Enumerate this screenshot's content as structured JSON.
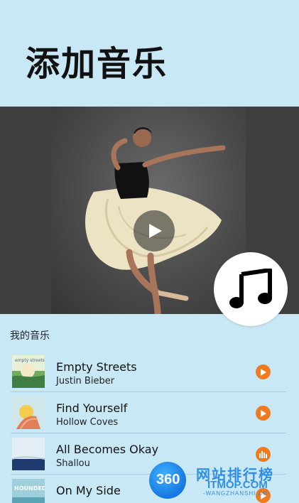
{
  "page": {
    "title": "添加音乐"
  },
  "video": {
    "play_icon": "play-icon"
  },
  "music_button": {
    "icon": "music-note-icon"
  },
  "section": {
    "label": "我的音乐"
  },
  "tracks": [
    {
      "name": "Empty Streets",
      "artist": "Justin Bieber",
      "action_icon": "play-icon",
      "thumb_text": "empty streets"
    },
    {
      "name": "Find Yourself",
      "artist": "Hollow  Coves",
      "action_icon": "play-icon",
      "thumb_text": ""
    },
    {
      "name": "All Becomes Okay",
      "artist": "Shallou",
      "action_icon": "equalizer-icon",
      "thumb_text": ""
    },
    {
      "name": "On My Side",
      "artist": "",
      "action_icon": "play-icon",
      "thumb_text": "HOUNDED"
    }
  ],
  "watermark": {
    "logo": "360",
    "cn": "网站排行榜",
    "en": "ITMOP.COM",
    "sub": "-WANGZHANSHI.CN-"
  },
  "colors": {
    "background": "#c9e8f5",
    "accent": "#f07a1e",
    "divider": "#a9cbdb"
  }
}
